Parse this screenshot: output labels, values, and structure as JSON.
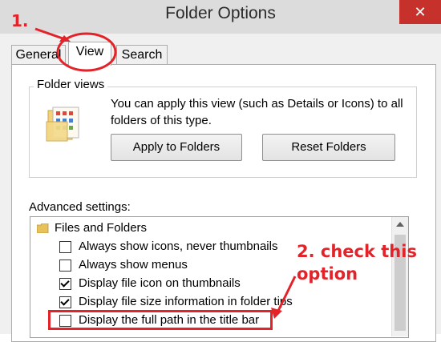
{
  "window": {
    "title": "Folder Options",
    "close_glyph": "✕"
  },
  "tabs": [
    {
      "label": "General"
    },
    {
      "label": "View",
      "selected": true
    },
    {
      "label": "Search"
    }
  ],
  "folder_views": {
    "legend": "Folder views",
    "description": "You can apply this view (such as Details or Icons) to all folders of this type.",
    "apply_button": "Apply to Folders",
    "reset_button": "Reset Folders",
    "icon": "folder-views-icon"
  },
  "advanced": {
    "label": "Advanced settings:",
    "items": [
      {
        "type": "folder",
        "label": "Files and Folders",
        "icon": "folder-icon"
      },
      {
        "type": "checkbox",
        "label": "Always show icons, never thumbnails",
        "checked": false
      },
      {
        "type": "checkbox",
        "label": "Always show menus",
        "checked": false
      },
      {
        "type": "checkbox",
        "label": "Display file icon on thumbnails",
        "checked": true
      },
      {
        "type": "checkbox",
        "label": "Display file size information in folder tips",
        "checked": true
      },
      {
        "type": "checkbox",
        "label": "Display the full path in the title bar",
        "checked": false
      }
    ]
  },
  "annotations": {
    "step1": "1.",
    "step2": "2. check this option",
    "color": "#e3232a"
  },
  "colors": {
    "close_button": "#c7312b",
    "titlebar": "#dcdcdc",
    "dialog": "#f0f0f0"
  }
}
